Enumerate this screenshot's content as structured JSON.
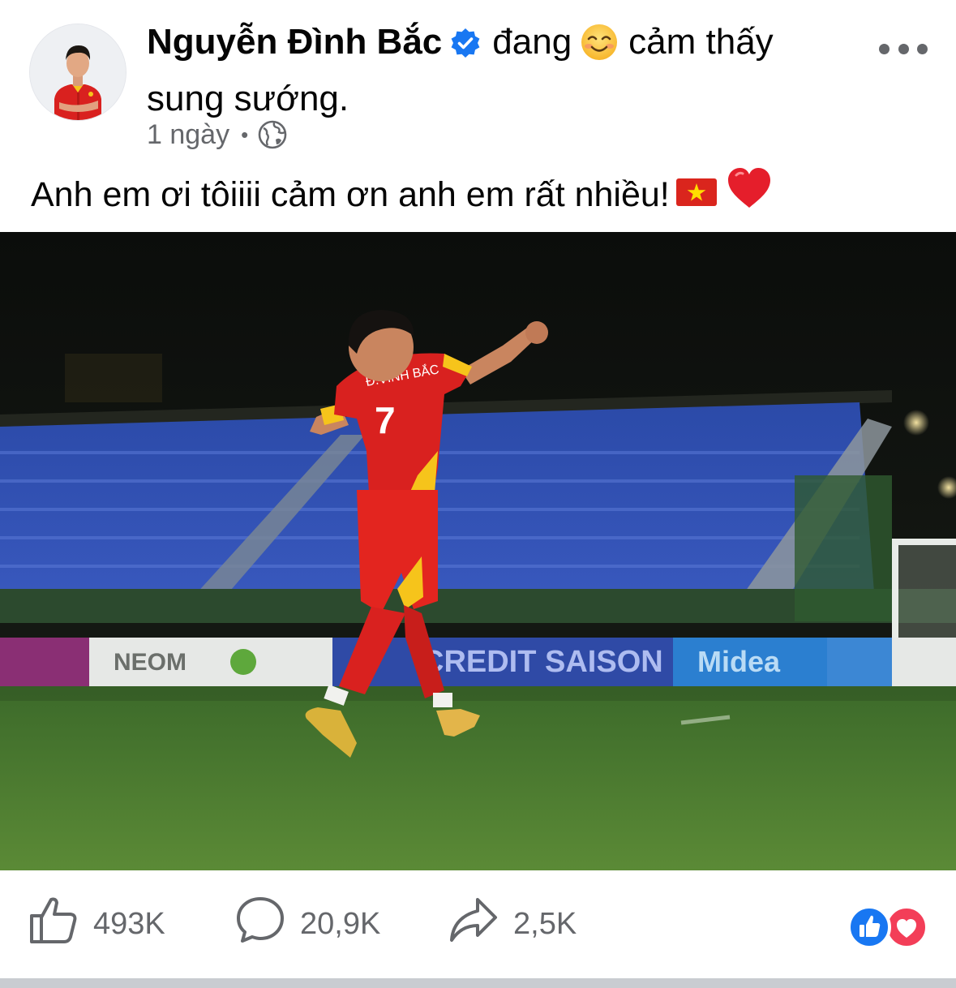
{
  "post": {
    "author": {
      "name": "Nguyễn Đình Bắc",
      "verified": true,
      "avatar_icon": "player-avatar"
    },
    "feeling": {
      "prefix": "đang",
      "emoji_icon": "smiling-face-icon",
      "text": "cảm thấy sung sướng."
    },
    "timestamp": "1 ngày",
    "separator": "•",
    "privacy_icon": "globe-icon",
    "body_text": "Anh em ơi tôiiii cảm ơn anh em rất nhiều!",
    "body_emojis": [
      "vietnam-flag-icon",
      "red-heart-icon"
    ],
    "photo": {
      "subject": "player-celebrating-jump-icon",
      "jersey_name": "Đ.VINH BẮC",
      "jersey_number": "7",
      "ad_boards": [
        "NEOM",
        "CREDIT SAISON",
        "Midea"
      ]
    }
  },
  "actions": {
    "like_count": "493K",
    "comment_count": "20,9K",
    "share_count": "2,5K"
  },
  "reaction_icons": [
    "like-reaction-icon",
    "love-reaction-icon"
  ],
  "colors": {
    "facebook_blue": "#1877f2",
    "love_red": "#f33e58",
    "secondary_text": "#65676b",
    "jersey_red": "#d9211f"
  }
}
